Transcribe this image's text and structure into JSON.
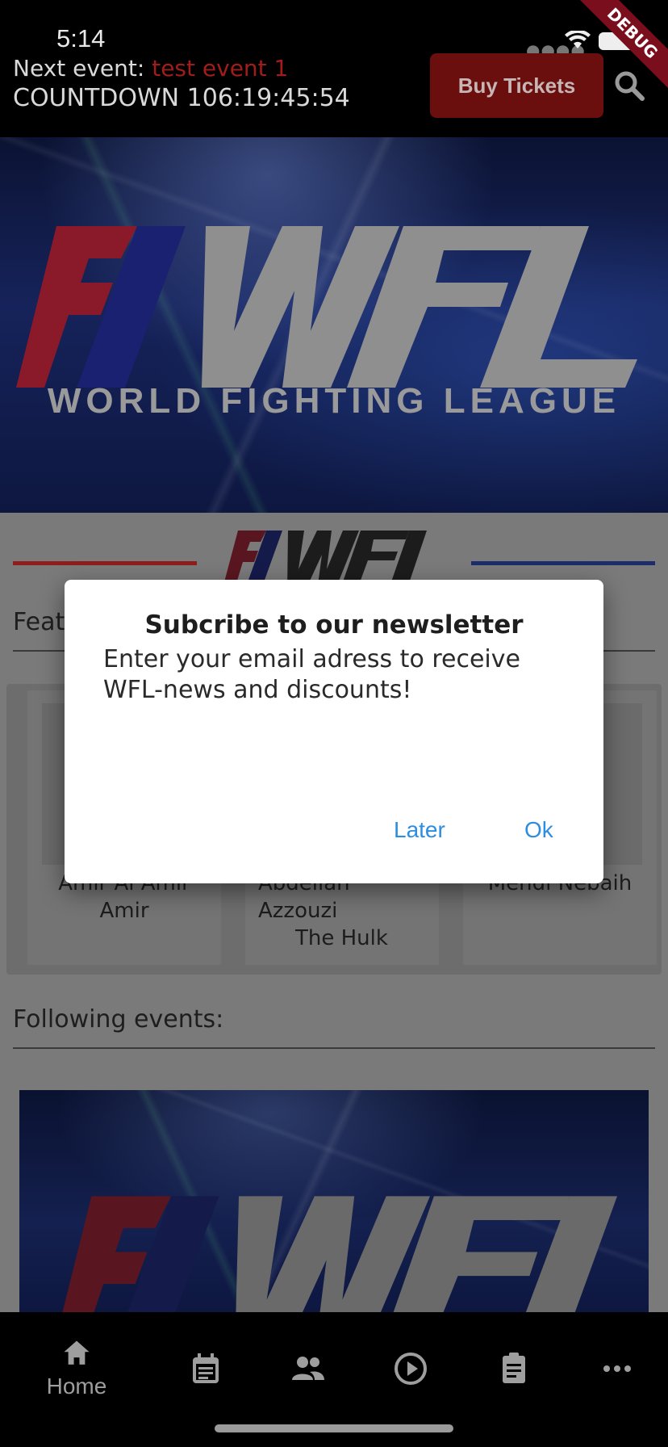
{
  "status_bar": {
    "time": "5:14"
  },
  "header": {
    "next_event_label": "Next event: ",
    "next_event_name": "test event 1",
    "countdown": "COUNTDOWN 106:19:45:54",
    "buy_label": "Buy Tickets",
    "debug_label": "DEBUG"
  },
  "hero": {
    "logo_text": "WFL",
    "subtitle": "WORLD FIGHTING LEAGUE"
  },
  "featured": {
    "title": "Feat",
    "fighters": [
      {
        "name_line1": "Amir Al Amir",
        "name_line2": "Amir"
      },
      {
        "name_line1": "Abdellah",
        "name_line2": "Azzouzi",
        "name_line3": "The Hulk"
      },
      {
        "name_line1": "Mehdi Nebaih"
      }
    ]
  },
  "following": {
    "title": "Following events:"
  },
  "dialog": {
    "title": "Subcribe to our newsletter",
    "body": "Enter your email adress to receive WFL-news and discounts!",
    "later": "Later",
    "ok": "Ok"
  },
  "nav": {
    "home_label": "Home",
    "items": [
      "home-icon",
      "calendar-icon",
      "people-icon",
      "play-icon",
      "clipboard-icon",
      "more-icon"
    ]
  },
  "colors": {
    "accent_red": "#a21c1c",
    "dialog_button": "#2d8de0"
  }
}
